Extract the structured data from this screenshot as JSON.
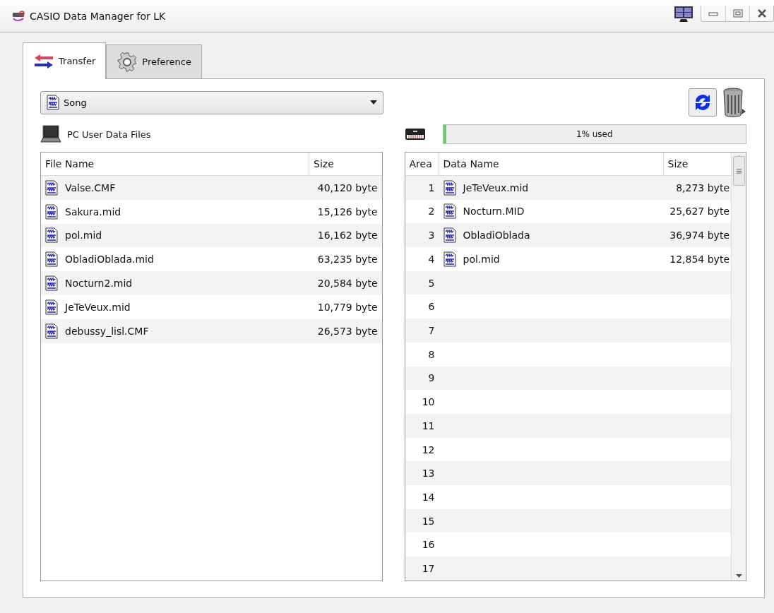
{
  "window": {
    "title": "CASIO Data Manager for LK"
  },
  "tabs": [
    {
      "label": "Transfer",
      "kind": "transfer",
      "selected": true
    },
    {
      "label": "Preference",
      "kind": "preference",
      "selected": false
    }
  ],
  "category_dropdown": {
    "value": "Song"
  },
  "pc_panel": {
    "label": "PC User Data Files",
    "columns": [
      "File Name",
      "Size"
    ],
    "rows": [
      {
        "name": "Valse.CMF",
        "size": "40,120 byte"
      },
      {
        "name": "Sakura.mid",
        "size": "15,126 byte"
      },
      {
        "name": "pol.mid",
        "size": "16,162 byte"
      },
      {
        "name": "ObladiOblada.mid",
        "size": "63,235 byte"
      },
      {
        "name": "Nocturn2.mid",
        "size": "20,584 byte"
      },
      {
        "name": "JeTeVeux.mid",
        "size": "10,779 byte"
      },
      {
        "name": "debussy_lisl.CMF",
        "size": "26,573 byte"
      }
    ]
  },
  "device_panel": {
    "usage": {
      "label": "1% used",
      "level": 0.01
    },
    "columns": [
      "Area",
      "Data Name",
      "Size"
    ],
    "rows": [
      {
        "area": "1",
        "name": "JeTeVeux.mid",
        "size": "8,273 byte"
      },
      {
        "area": "2",
        "name": "Nocturn.MID",
        "size": "25,627 byte"
      },
      {
        "area": "3",
        "name": "ObladiOblada",
        "size": "36,974 byte"
      },
      {
        "area": "4",
        "name": "pol.mid",
        "size": "12,854 byte"
      },
      {
        "area": "5"
      },
      {
        "area": "6"
      },
      {
        "area": "7"
      },
      {
        "area": "8"
      },
      {
        "area": "9"
      },
      {
        "area": "10"
      },
      {
        "area": "11"
      },
      {
        "area": "12"
      },
      {
        "area": "13"
      },
      {
        "area": "14"
      },
      {
        "area": "15"
      },
      {
        "area": "16"
      },
      {
        "area": "17"
      }
    ]
  }
}
